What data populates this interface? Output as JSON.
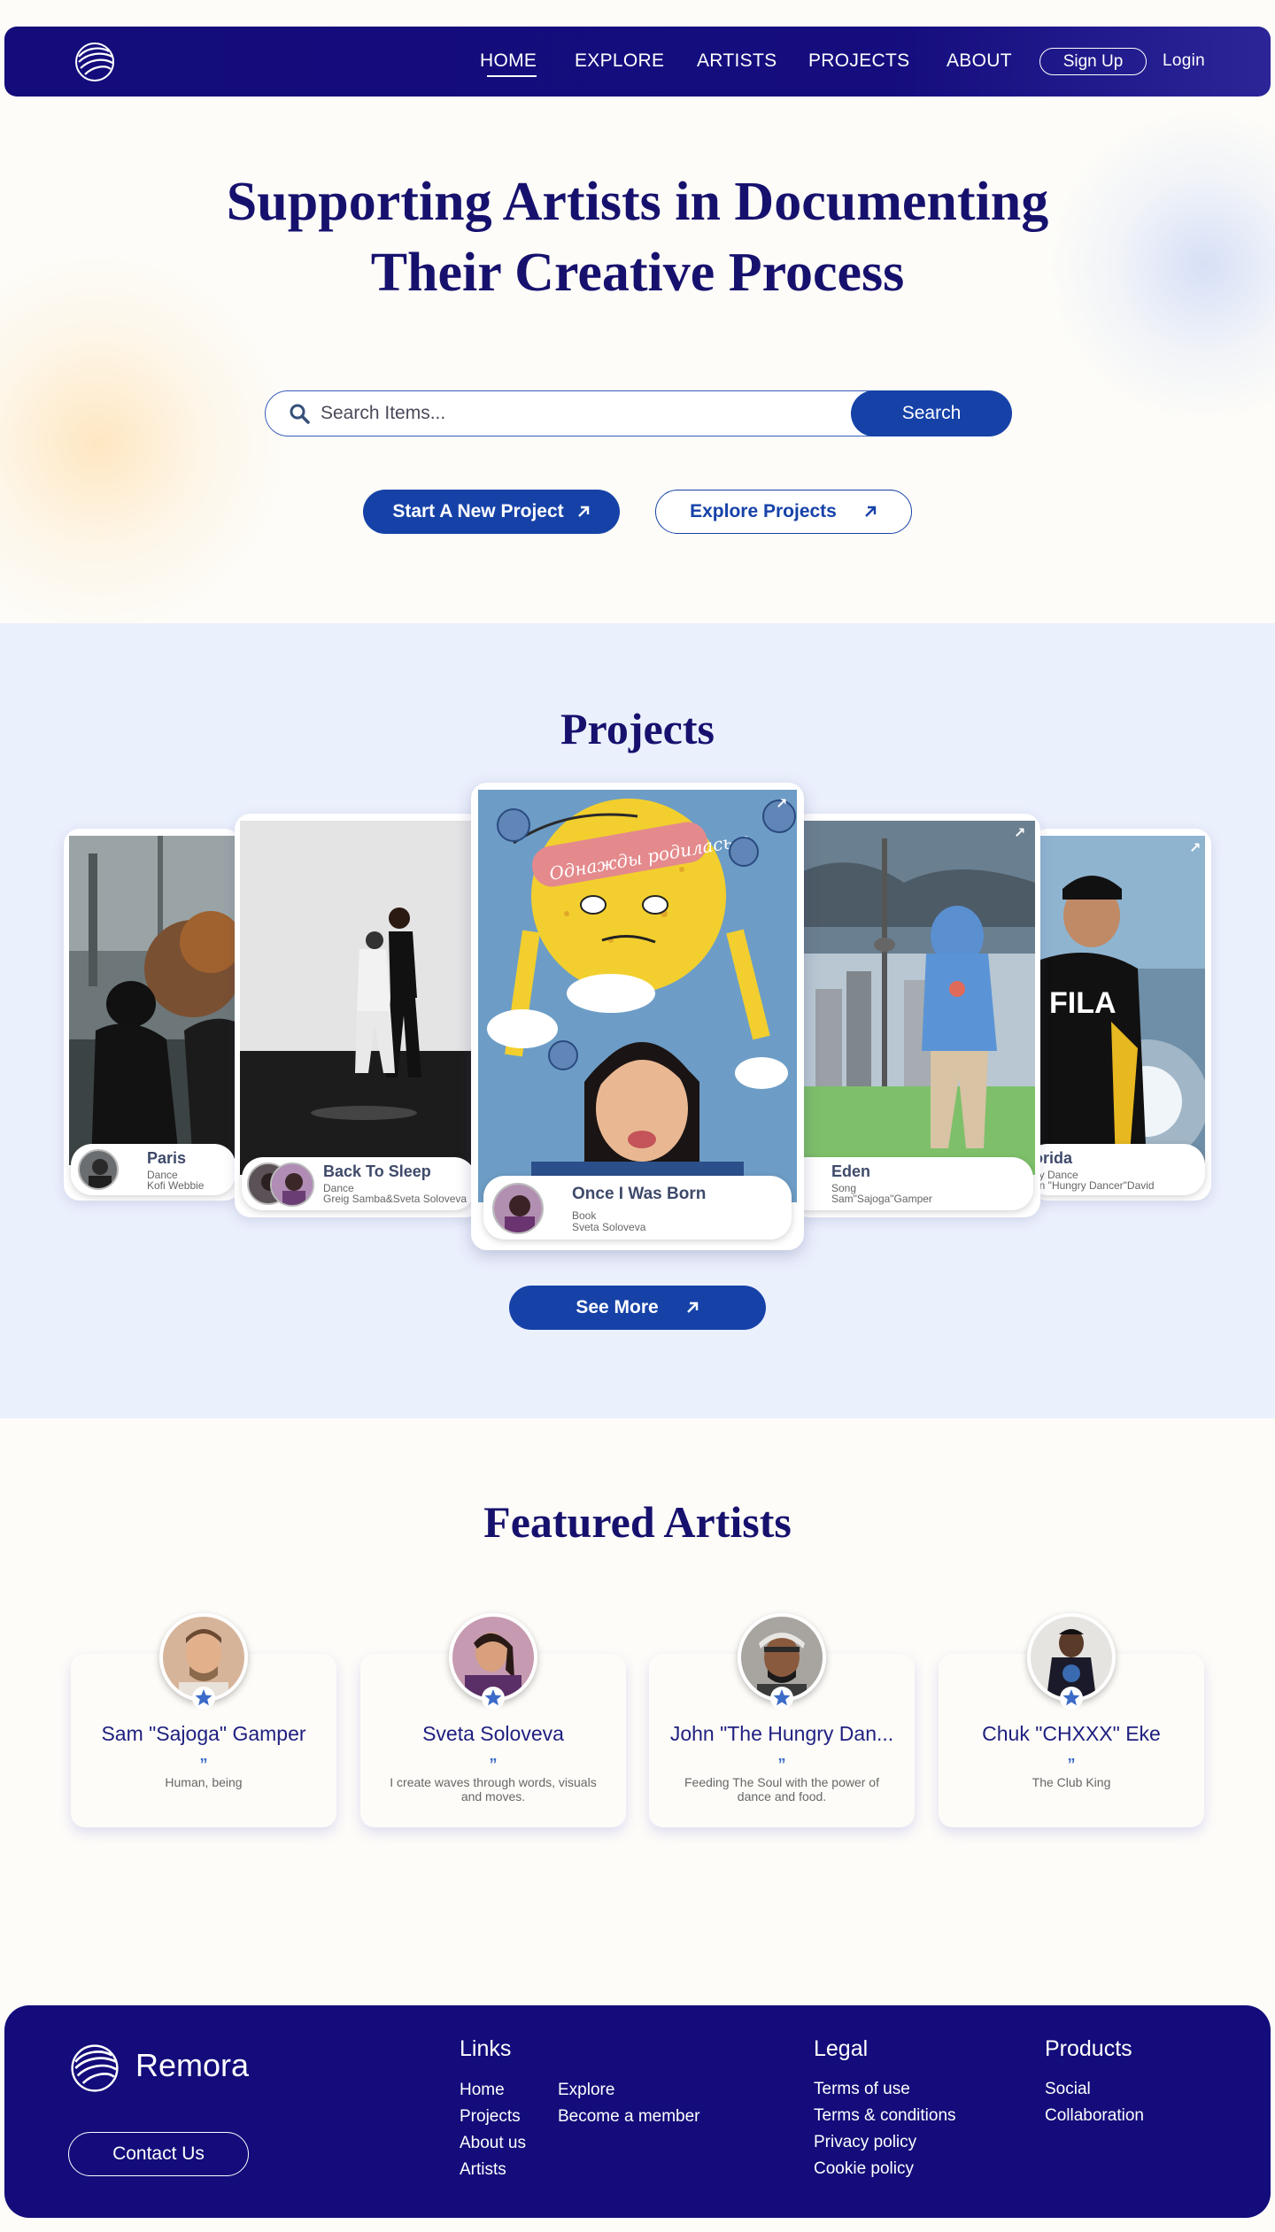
{
  "nav": {
    "links": [
      "HOME",
      "EXPLORE",
      "ARTISTS",
      "PROJECTS",
      "ABOUT"
    ],
    "signup_label": "Sign Up",
    "login_label": "Login"
  },
  "hero": {
    "title_line1": "Supporting Artists in Documenting",
    "title_line2": "Their Creative Process",
    "search_placeholder": "Search Items...",
    "search_button": "Search",
    "primary_button": "Start A New Project",
    "secondary_button": "Explore Projects"
  },
  "projects": {
    "title": "Projects",
    "cards": [
      {
        "title": "Paris",
        "type": "Dance",
        "artist": "Kofi Webbie"
      },
      {
        "title": "Back To Sleep",
        "type": "Dance",
        "artist": "Greig Samba&Sveta Soloveva"
      },
      {
        "title": "Once I Was Born",
        "type": "Book",
        "artist": "Sveta Soloveva",
        "art_text": "Однажды родилась я"
      },
      {
        "title": "Eden",
        "type": "Song",
        "artist": "Sam\"Sajoga\"Gamper"
      },
      {
        "title": "orida",
        "type": "oy Dance",
        "artist": "hn \"Hungry Dancer\"David"
      }
    ],
    "see_more": "See More"
  },
  "artists": {
    "title": "Featured Artists",
    "quote_mark": "”",
    "items": [
      {
        "name": "Sam \"Sajoga\" Gamper",
        "bio": "Human, being"
      },
      {
        "name": "Sveta Soloveva",
        "bio": "I create waves through words, visuals and moves."
      },
      {
        "name": "John \"The Hungry Dan...",
        "bio": "Feeding The Soul with the power of dance and food."
      },
      {
        "name": "Chuk \"CHXXX\" Eke",
        "bio": "The Club King"
      }
    ]
  },
  "footer": {
    "brand": "Remora",
    "contact_button": "Contact Us",
    "links_title": "Links",
    "links_col1": [
      "Home",
      "Projects",
      "About us",
      "Artists"
    ],
    "links_col2": [
      "Explore",
      "Become a member"
    ],
    "legal_title": "Legal",
    "legal": [
      "Terms of use",
      "Terms & conditions",
      "Privacy policy",
      "Cookie policy"
    ],
    "products_title": "Products",
    "products": [
      "Social",
      "Collaboration"
    ]
  },
  "colors": {
    "navy": "#130c7a",
    "title": "#17116e",
    "button_blue": "#1642a8",
    "projects_bg": "#ebf0fd",
    "page_bg": "#fdfcf8",
    "star_blue": "#3b6ac8"
  }
}
